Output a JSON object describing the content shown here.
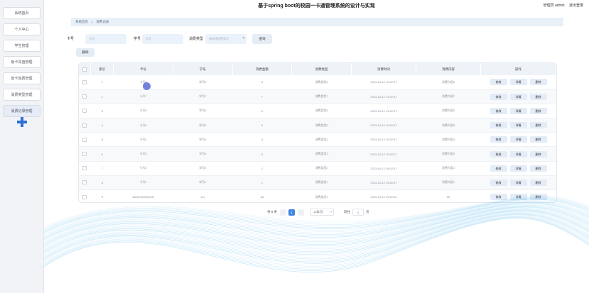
{
  "app": {
    "title": "基于spring boot的校园一卡通管理系统的设计与实现"
  },
  "user": {
    "role_label": "管理员 admin",
    "logout_label": "退出登录"
  },
  "sidebar": {
    "items": [
      {
        "label": "系统首页"
      },
      {
        "label": "个人中心"
      },
      {
        "label": "学生管理"
      },
      {
        "label": "饭卡充值管理"
      },
      {
        "label": "饭卡消费管理"
      },
      {
        "label": "消费类型管理"
      },
      {
        "label": "消费记录管理"
      }
    ]
  },
  "breadcrumb": {
    "home": "系统首页",
    "current": "消费记录"
  },
  "filters": {
    "card_label": "卡号",
    "card_placeholder": "卡号",
    "student_label": "学号",
    "student_placeholder": "学号",
    "type_label": "消费类型",
    "type_placeholder": "请选择消费类型",
    "query_label": "查询"
  },
  "actions": {
    "delete_label": "删除"
  },
  "table": {
    "headers": [
      "索引",
      "卡号",
      "学号",
      "消费金额",
      "消费类型",
      "消费时间",
      "消费内容",
      "操作"
    ],
    "row_actions": [
      "修改",
      "详情",
      "删除"
    ],
    "rows": [
      [
        "1",
        "卡号5",
        "学号5",
        "5",
        "消费类型5",
        "2023-04-12 19:52:37",
        "消费内容5"
      ],
      [
        "2",
        "卡号7",
        "学号7",
        "7",
        "消费类型7",
        "2023-04-12 19:52:37",
        "消费内容7"
      ],
      [
        "3",
        "卡号6",
        "学号6",
        "6",
        "消费类型6",
        "2023-04-12 19:52:37",
        "消费内容6"
      ],
      [
        "4",
        "卡号5",
        "学号5",
        "5",
        "消费类型5",
        "2023-04-12 19:52:37",
        "消费内容5"
      ],
      [
        "5",
        "卡号4",
        "学号4",
        "4",
        "消费类型4",
        "2023-04-12 19:52:37",
        "消费内容4"
      ],
      [
        "6",
        "卡号3",
        "学号3",
        "3",
        "消费类型3",
        "2023-04-12 19:52:37",
        "消费内容3"
      ],
      [
        "7",
        "卡号2",
        "学号2",
        "2",
        "消费类型2",
        "2023-04-12 19:52:37",
        "消费内容2"
      ],
      [
        "8",
        "卡号1",
        "学号1",
        "1",
        "消费类型1",
        "2023-04-12 19:52:37",
        "消费内容1"
      ],
      [
        "9",
        "16812460053443",
        "111",
        "66",
        "消费类型1",
        "2023-04-12 19:52:34",
        "66"
      ]
    ]
  },
  "pagination": {
    "total_label": "共 9 条",
    "prev_icon": "‹",
    "current_page": "1",
    "next_icon": "›",
    "page_size": "10条/页",
    "goto_prefix": "前往",
    "goto_value": "1",
    "goto_suffix": "页"
  },
  "colors": {
    "accent": "#3f85e2",
    "sidebar_bg": "#f1f3f6",
    "wave": "#4fb3e8"
  }
}
